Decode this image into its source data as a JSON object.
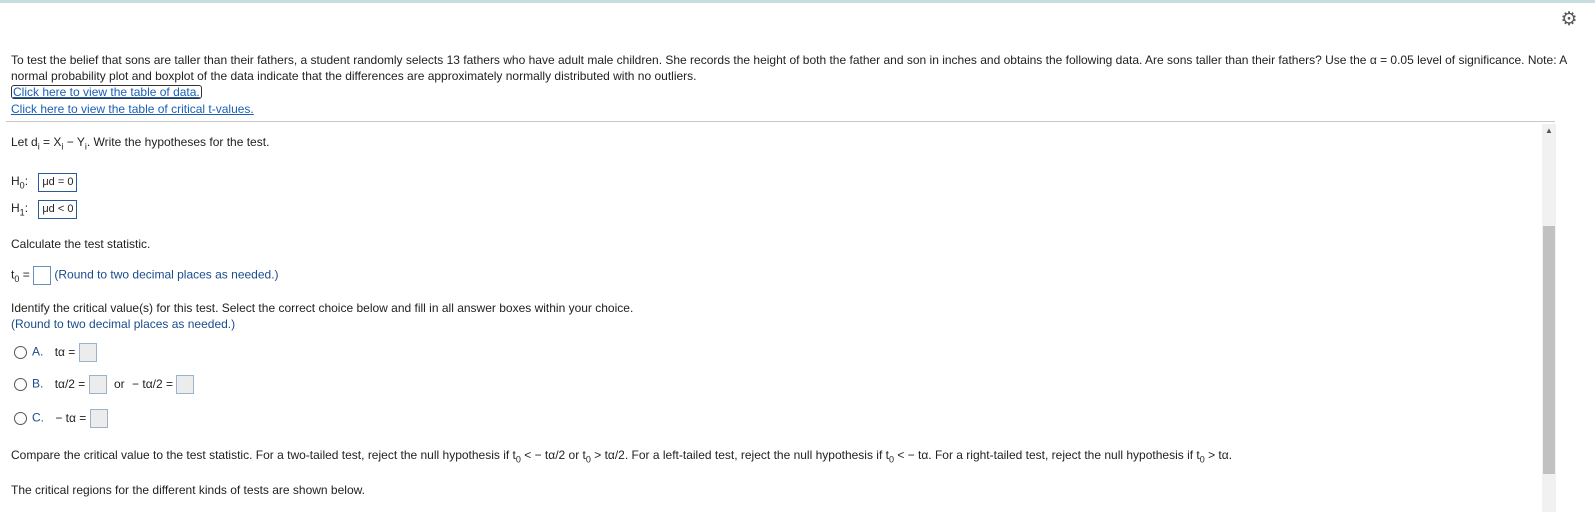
{
  "header": {
    "settings_icon": "gear-icon"
  },
  "intro": {
    "text": "To test the belief that sons are taller than their fathers, a student randomly selects 13 fathers who have adult male children. She records the height of both the father and son in inches and obtains the following data. Are sons taller than their fathers? Use the α = 0.05 level of significance. Note: A normal probability plot and boxplot of the data indicate that the differences are approximately normally distributed with no outliers.",
    "data_link": "Click here to view the table of data.",
    "tvalues_link": "Click here to view the table of critical t-values."
  },
  "question": {
    "define_pre": "Let d",
    "define_mid": " = X",
    "define_mid2": " − Y",
    "define_post": ". Write the hypotheses for the test.",
    "sub_i": "i",
    "h0_label": "H",
    "h0_sub": "0",
    "h0_value": "μd = 0",
    "h1_label": "H",
    "h1_sub": "1",
    "h1_value": "μd < 0",
    "calc_prompt": "Calculate the test statistic.",
    "t0_label": "t",
    "t0_sub": "0",
    "equals": " =",
    "round_hint": "(Round to two decimal places as needed.)",
    "critical_prompt": "Identify the critical value(s) for this test. Select the correct choice below and fill in all answer boxes within your choice.",
    "critical_hint": "(Round to two decimal places as needed.)"
  },
  "choices": [
    {
      "letter": "A.",
      "math": "tα ="
    },
    {
      "letter": "B.",
      "math_left": "tα/2 =",
      "or_text": "or",
      "math_right": "− tα/2 ="
    },
    {
      "letter": "C.",
      "math": "− tα ="
    }
  ],
  "compare": {
    "text_1": "Compare the critical value to the test statistic. For a two-tailed test, reject the null hypothesis if t",
    "text_2": " < − tα/2  or t",
    "text_3": " > tα/2. For a left-tailed test, reject the null hypothesis if t",
    "text_4": " < − tα. For a right-tailed test, reject the null hypothesis if t",
    "text_5": " > tα.",
    "sub0": "0"
  },
  "regions": {
    "text": "The critical regions for the different kinds of tests are shown below."
  }
}
